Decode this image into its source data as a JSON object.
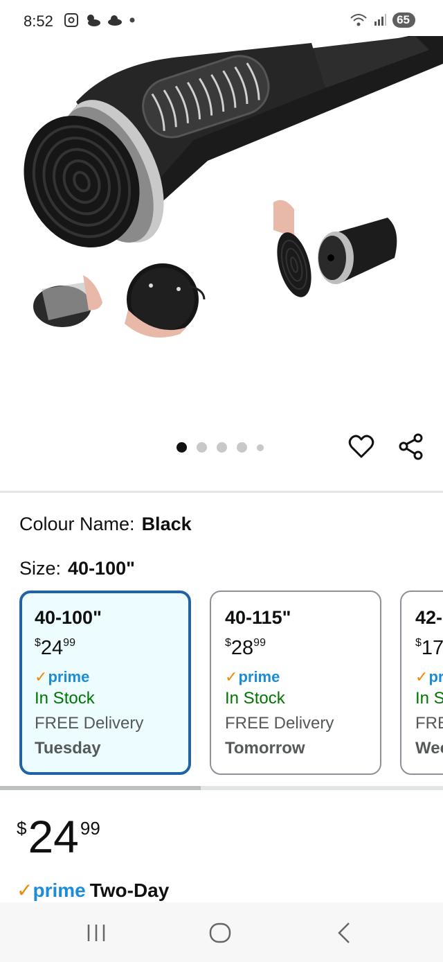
{
  "status_bar": {
    "time": "8:52",
    "battery": "65",
    "icons_left": [
      "screenshot-icon",
      "weather-icon",
      "cloud-icon",
      "dot-icon"
    ],
    "icons_right": [
      "wifi-icon",
      "signal-icon",
      "battery-icon"
    ]
  },
  "carousel": {
    "dot_count": 5,
    "active_index": 0
  },
  "variation": {
    "colour_label": "Colour Name:",
    "colour_value": "Black",
    "size_label": "Size:",
    "size_value": "40-100\""
  },
  "size_options": [
    {
      "size": "40-100\"",
      "currency": "$",
      "price_whole": "24",
      "price_cents": "99",
      "prime": "prime",
      "stock": "In Stock",
      "delivery": "FREE Delivery",
      "delivery_day": "Tuesday",
      "selected": true
    },
    {
      "size": "40-115\"",
      "currency": "$",
      "price_whole": "28",
      "price_cents": "99",
      "prime": "prime",
      "stock": "In Stock",
      "delivery": "FREE Delivery",
      "delivery_day": "Tomorrow",
      "selected": false
    },
    {
      "size": "42-",
      "currency": "$",
      "price_whole": "17",
      "price_cents": "",
      "prime": "pri",
      "stock": "In S",
      "delivery": "FRE",
      "delivery_day": "Wec",
      "selected": false
    }
  ],
  "price": {
    "currency": "$",
    "whole": "24",
    "cents": "99"
  },
  "shipping": {
    "prime": "prime",
    "label": "Two-Day"
  },
  "colors": {
    "selected_border": "#2162a1",
    "selected_bg": "#edfdff",
    "prime_blue": "#1c8cd8",
    "prime_check": "#f08804",
    "in_stock": "#007600"
  }
}
